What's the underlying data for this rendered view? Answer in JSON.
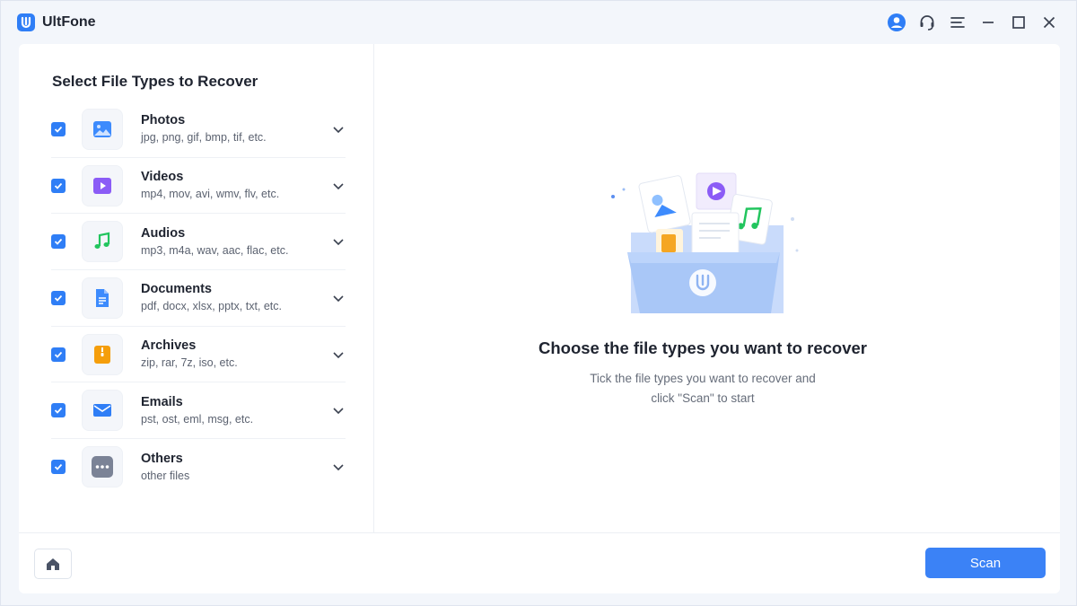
{
  "app": {
    "title": "UltFone"
  },
  "left_panel": {
    "title": "Select File Types to Recover",
    "types": [
      {
        "name": "Photos",
        "extensions": "jpg, png, gif, bmp, tif, etc.",
        "checked": true,
        "icon": "photo-icon"
      },
      {
        "name": "Videos",
        "extensions": "mp4, mov, avi, wmv, flv, etc.",
        "checked": true,
        "icon": "video-icon"
      },
      {
        "name": "Audios",
        "extensions": "mp3, m4a, wav, aac, flac, etc.",
        "checked": true,
        "icon": "music-icon"
      },
      {
        "name": "Documents",
        "extensions": "pdf, docx, xlsx, pptx, txt, etc.",
        "checked": true,
        "icon": "document-icon"
      },
      {
        "name": "Archives",
        "extensions": "zip, rar, 7z, iso, etc.",
        "checked": true,
        "icon": "archive-icon"
      },
      {
        "name": "Emails",
        "extensions": "pst, ost, eml, msg, etc.",
        "checked": true,
        "icon": "email-icon"
      },
      {
        "name": "Others",
        "extensions": "other files",
        "checked": true,
        "icon": "more-icon"
      }
    ]
  },
  "right_panel": {
    "headline": "Choose the file types you want to recover",
    "subtext_line1": "Tick the file types you want to recover and",
    "subtext_line2": "click \"Scan\" to start"
  },
  "footer": {
    "scan_label": "Scan"
  },
  "colors": {
    "accent": "#3b82f6",
    "checkbox": "#2f7ef6"
  }
}
